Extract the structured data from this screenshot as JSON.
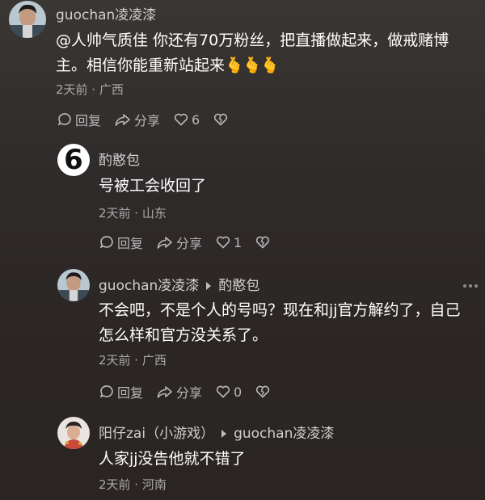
{
  "comments": [
    {
      "username": "guochan凌凌漆",
      "text_line1": "@人帅气质佳 你还有70万粉丝，把直播做起来，做戒赌博",
      "text_line2": "主。相信你能重新站起来",
      "emojis": [
        "🫰",
        "🫰",
        "🫰"
      ],
      "meta": "2天前 · 广西",
      "reply_label": "回复",
      "share_label": "分享",
      "like_count": "6"
    },
    {
      "username": "酌憨包",
      "text": "号被工会收回了",
      "meta": "2天前 · 山东",
      "reply_label": "回复",
      "share_label": "分享",
      "like_count": "1"
    },
    {
      "username": "guochan凌凌漆",
      "reply_to": "酌憨包",
      "text_line1": "不会吧，不是个人的号吗？现在和jj官方解约了，自己",
      "text_line2": "怎么样和官方没关系了。",
      "meta": "2天前 · 广西",
      "reply_label": "回复",
      "share_label": "分享",
      "like_count": "0"
    },
    {
      "username": "阳仔zai（小游戏）",
      "reply_to": "guochan凌凌漆",
      "text": "人家jj没告他就不错了",
      "meta": "2天前 · 河南"
    }
  ],
  "avatar2_glyph": "6"
}
